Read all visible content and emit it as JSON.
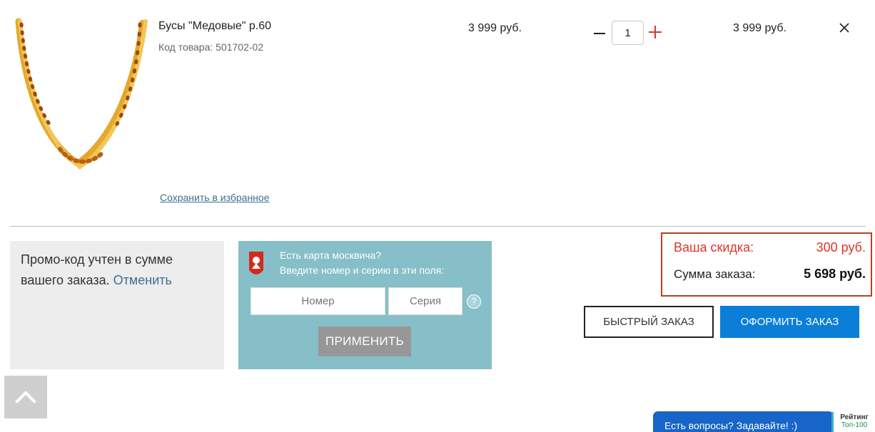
{
  "product": {
    "title": "Бусы \"Медовые\" р.60",
    "code": "Код товара: 501702-02",
    "price": "3 999 руб.",
    "quantity": "1",
    "total": "3 999 руб.",
    "save_favorite": "Сохранить в избранное"
  },
  "promo": {
    "text": "Промо-код учтен в сумме вашего заказа.",
    "cancel": "Отменить"
  },
  "moscow_card": {
    "line1": "Есть карта москвича?",
    "line2": "Введите номер и серию в эти поля:",
    "number_placeholder": "Номер",
    "series_placeholder": "Серия",
    "help": "?",
    "apply": "ПРИМЕНИТЬ"
  },
  "summary": {
    "discount_label": "Ваша скидка:",
    "discount_value": "300 руб.",
    "total_label": "Сумма заказа:",
    "total_value": "5 698 руб."
  },
  "actions": {
    "quick_order": "БЫСТРЫЙ ЗАКАЗ",
    "checkout": "ОФОРМИТЬ ЗАКАЗ"
  },
  "chat": {
    "label": "Есть вопросы? Задавайте! :)"
  },
  "rating_badge": {
    "line1": "Рейтинг",
    "line2": "Топ-100"
  },
  "colors": {
    "accent_blue": "#0b7ed8",
    "discount_red": "#d9372a",
    "card_panel": "#86bfc7",
    "summary_border": "#b3441e"
  },
  "icons": {
    "remove": "close-icon",
    "scroll_top": "chevron-up-icon",
    "emblem": "moscow-emblem-icon"
  }
}
